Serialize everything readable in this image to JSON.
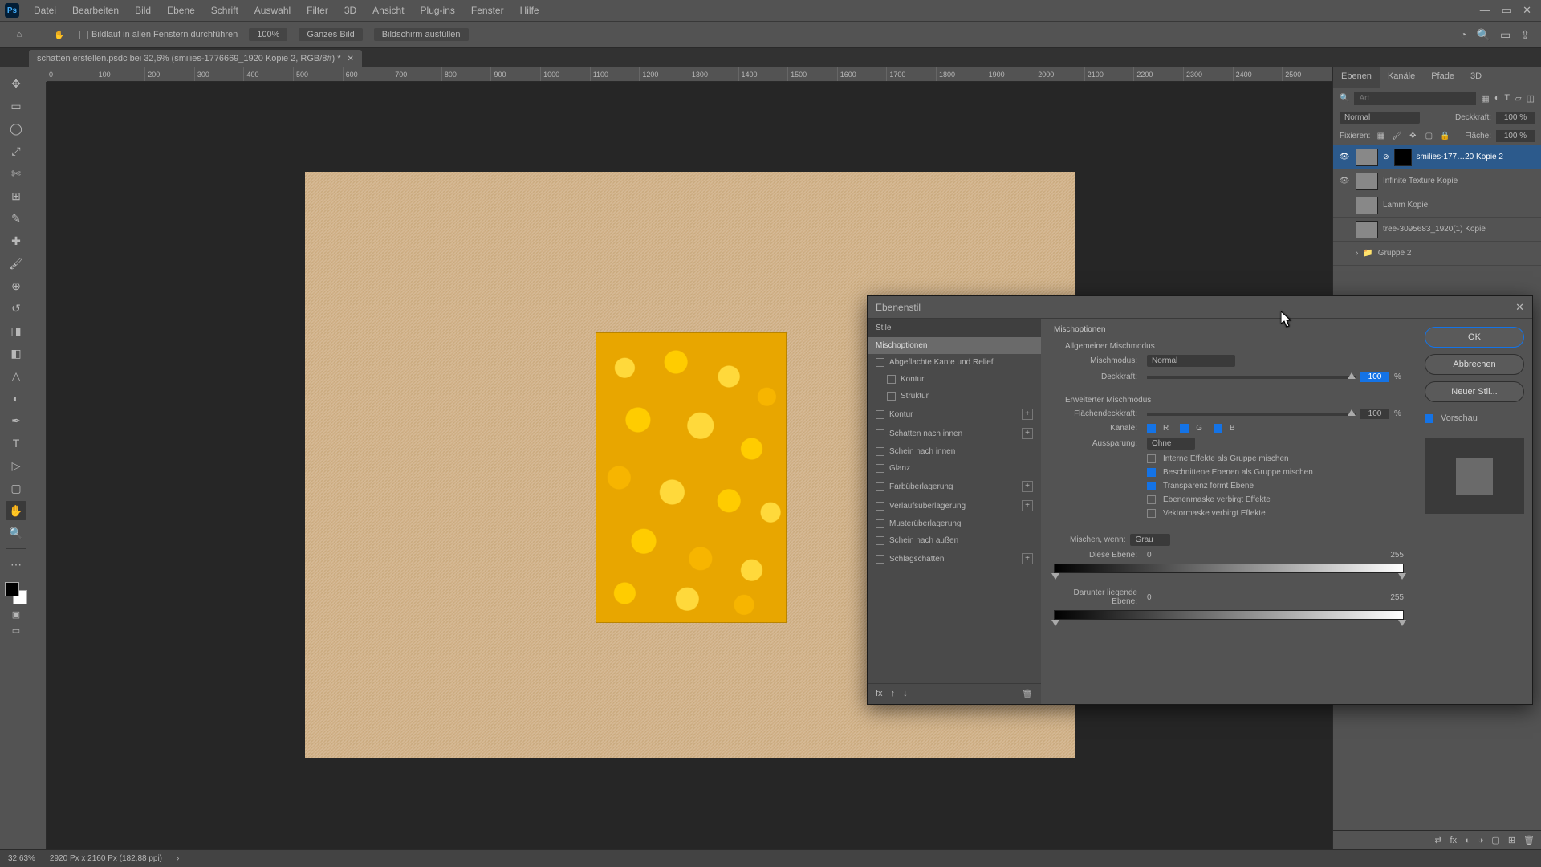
{
  "app": {
    "logo": "Ps"
  },
  "menu": [
    "Datei",
    "Bearbeiten",
    "Bild",
    "Ebene",
    "Schrift",
    "Auswahl",
    "Filter",
    "3D",
    "Ansicht",
    "Plug-ins",
    "Fenster",
    "Hilfe"
  ],
  "optbar": {
    "scroll_all": "Bildlauf in allen Fenstern durchführen",
    "zoom100": "100%",
    "fit": "Ganzes Bild",
    "fill": "Bildschirm ausfüllen"
  },
  "doc": {
    "tab": "schatten erstellen.psdc bei 32,6% (smilies-1776669_1920 Kopie 2, RGB/8#) *"
  },
  "ruler_marks": [
    "0",
    "100",
    "200",
    "300",
    "400",
    "500",
    "600",
    "700",
    "800",
    "900",
    "1000",
    "1100",
    "1200",
    "1300",
    "1400",
    "1500",
    "1600",
    "1700",
    "1800",
    "1900",
    "2000",
    "2100",
    "2200",
    "2300",
    "2400",
    "2500"
  ],
  "panels": {
    "tabs": [
      "Ebenen",
      "Kanäle",
      "Pfade",
      "3D"
    ],
    "search_placeholder": "Art",
    "blend_mode": "Normal",
    "opacity_label": "Deckkraft:",
    "opacity_value": "100 %",
    "lock_label": "Fixieren:",
    "fill_label": "Fläche:",
    "fill_value": "100 %",
    "layers": [
      {
        "name": "smilies-177…20 Kopie 2",
        "visible": true,
        "sel": true,
        "mask": true
      },
      {
        "name": "Infinite Texture Kopie",
        "visible": true,
        "sel": false,
        "mask": false
      },
      {
        "name": "Lamm Kopie",
        "visible": false,
        "sel": false,
        "mask": false
      },
      {
        "name": "tree-3095683_1920(1) Kopie",
        "visible": false,
        "sel": false,
        "mask": false
      },
      {
        "name": "Gruppe 2",
        "visible": false,
        "sel": false,
        "group": true
      }
    ]
  },
  "dialog": {
    "title": "Ebenenstil",
    "styles_header": "Stile",
    "styles": [
      {
        "label": "Mischoptionen",
        "active": true,
        "checkbox": false,
        "plus": false
      },
      {
        "label": "Abgeflachte Kante und Relief",
        "active": false,
        "checkbox": true,
        "plus": false
      },
      {
        "label": "Kontur",
        "active": false,
        "checkbox": true,
        "plus": false,
        "indent": true
      },
      {
        "label": "Struktur",
        "active": false,
        "checkbox": true,
        "plus": false,
        "indent": true
      },
      {
        "label": "Kontur",
        "active": false,
        "checkbox": true,
        "plus": true
      },
      {
        "label": "Schatten nach innen",
        "active": false,
        "checkbox": true,
        "plus": true
      },
      {
        "label": "Schein nach innen",
        "active": false,
        "checkbox": true,
        "plus": false
      },
      {
        "label": "Glanz",
        "active": false,
        "checkbox": true,
        "plus": false
      },
      {
        "label": "Farbüberlagerung",
        "active": false,
        "checkbox": true,
        "plus": true
      },
      {
        "label": "Verlaufsüberlagerung",
        "active": false,
        "checkbox": true,
        "plus": true
      },
      {
        "label": "Musterüberlagerung",
        "active": false,
        "checkbox": true,
        "plus": false
      },
      {
        "label": "Schein nach außen",
        "active": false,
        "checkbox": true,
        "plus": false
      },
      {
        "label": "Schlagschatten",
        "active": false,
        "checkbox": true,
        "plus": true
      }
    ],
    "opts": {
      "section1": "Mischoptionen",
      "general": "Allgemeiner Mischmodus",
      "mode_label": "Mischmodus:",
      "mode_value": "Normal",
      "opacity_label": "Deckkraft:",
      "opacity_value": "100",
      "advanced": "Erweiterter Mischmodus",
      "fill_label": "Flächendeckkraft:",
      "fill_value": "100",
      "channels_label": "Kanäle:",
      "ch_r": "R",
      "ch_g": "G",
      "ch_b": "B",
      "knockout_label": "Aussparung:",
      "knockout_value": "Ohne",
      "cb1": "Interne Effekte als Gruppe mischen",
      "cb2": "Beschnittene Ebenen als Gruppe mischen",
      "cb3": "Transparenz formt Ebene",
      "cb4": "Ebenenmaske verbirgt Effekte",
      "cb5": "Vektormaske verbirgt Effekte",
      "blendif_label": "Mischen, wenn:",
      "blendif_value": "Grau",
      "this_layer": "Diese Ebene:",
      "this_low": "0",
      "this_high": "255",
      "under_layer": "Darunter liegende Ebene:",
      "under_low": "0",
      "under_high": "255"
    },
    "buttons": {
      "ok": "OK",
      "cancel": "Abbrechen",
      "new_style": "Neuer Stil...",
      "preview": "Vorschau"
    }
  },
  "status": {
    "zoom": "32,63%",
    "info": "2920 Px x 2160 Px (182,88 ppi)"
  }
}
